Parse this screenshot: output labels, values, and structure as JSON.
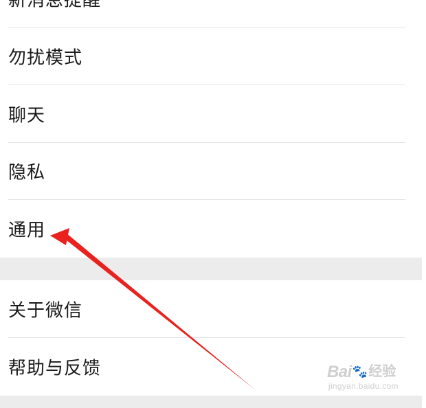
{
  "settings_group_1": {
    "items": [
      {
        "label": "新消息提醒"
      },
      {
        "label": "勿扰模式"
      },
      {
        "label": "聊天"
      },
      {
        "label": "隐私"
      },
      {
        "label": "通用"
      }
    ]
  },
  "settings_group_2": {
    "items": [
      {
        "label": "关于微信"
      },
      {
        "label": "帮助与反馈"
      }
    ]
  },
  "watermark": {
    "brand": "Bai",
    "paw_icon": "paw-icon",
    "suffix": "经验",
    "url": "jingyan.baidu.com"
  },
  "colors": {
    "background": "#ffffff",
    "section_gap": "#ececec",
    "divider": "#e6e6e6",
    "text": "#1a1a1a",
    "annotation_arrow": "#e8231f"
  }
}
